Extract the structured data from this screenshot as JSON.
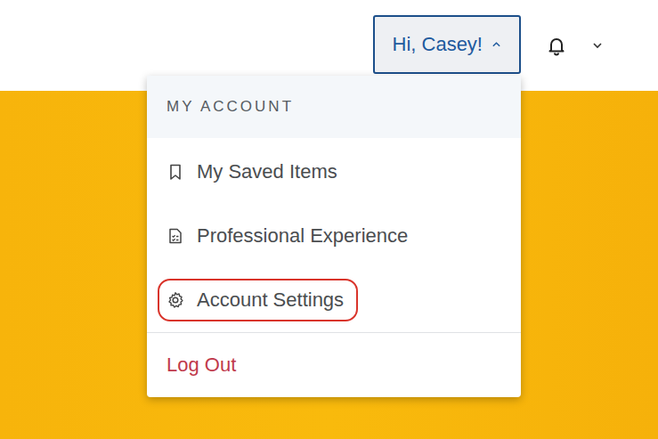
{
  "header": {
    "greeting": "Hi, Casey!",
    "menu_expanded": true
  },
  "menu": {
    "title": "MY ACCOUNT",
    "items": [
      {
        "label": "My Saved Items",
        "kind": "bookmark",
        "highlighted": false
      },
      {
        "label": "Professional Experience",
        "kind": "checklist",
        "highlighted": false
      },
      {
        "label": "Account Settings",
        "kind": "gear",
        "highlighted": true
      }
    ],
    "logout": "Log Out"
  }
}
